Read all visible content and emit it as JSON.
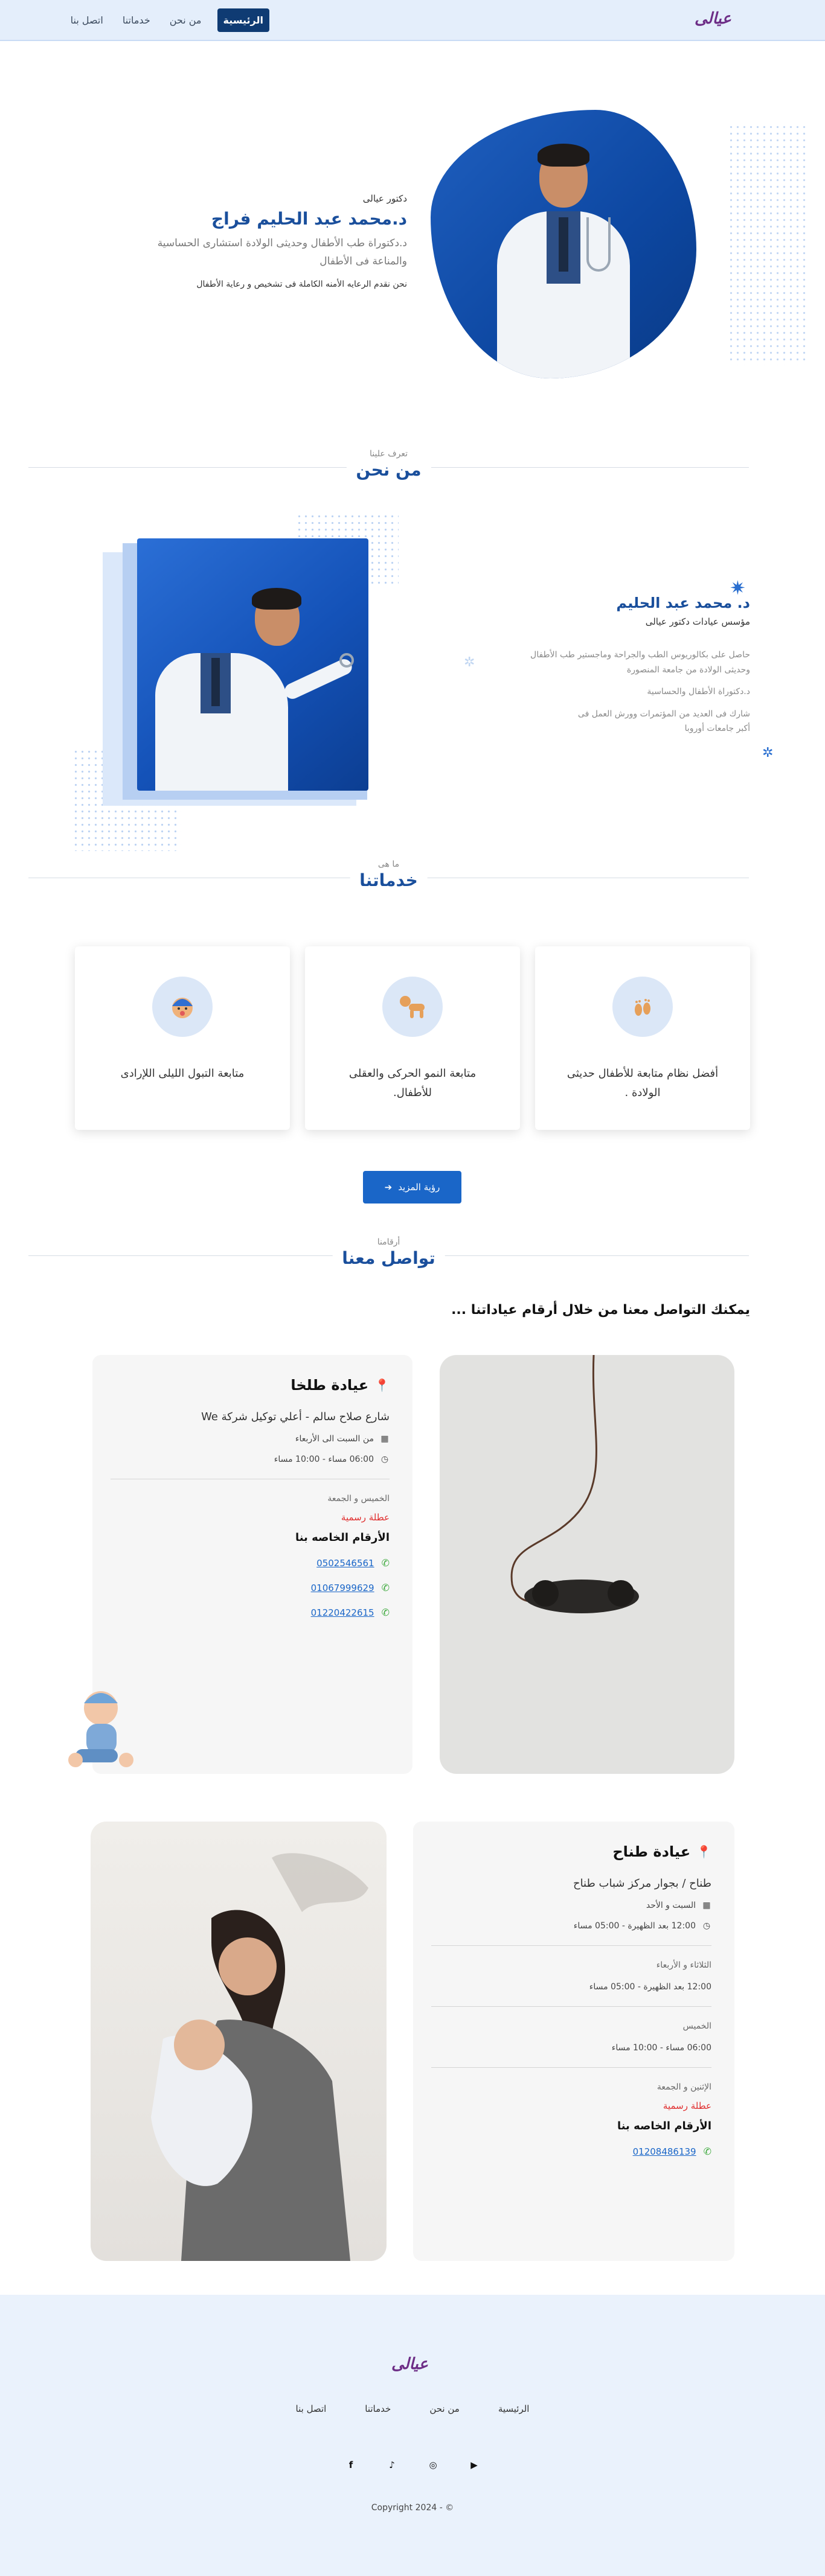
{
  "nav": {
    "brand": "عيالى",
    "links": [
      "الرئيسية",
      "من نحن",
      "خدماتنا",
      "اتصل بنا"
    ]
  },
  "hero": {
    "small": "دكتور عيالى",
    "name": "د.محمد عبد الحليم فراج",
    "desc1": "د.دكتوراة طب الأطفال وحديثى الولادة استشارى الحساسية",
    "desc2": "والمناعة فى الأطفال",
    "sub": "نحن نقدم الرعايه الأمنه الكاملة فى تشخيص و رعاية الأطفال"
  },
  "about": {
    "small": "تعرف علينا",
    "title": "من نحن",
    "name": "د. محمد عبد الحليم",
    "role": "مؤسس عيادات دكتور عيالى",
    "line1": "حاصل على بكالوريوس الطب والجراحة وماجستير طب الأطفال",
    "line2": "وحديثى الولادة من جامعة المنصورة",
    "line3": "د.دكتوراة الأطفال والحساسية",
    "line4": "شارك فى العديد من المؤتمرات وورش العمل فى",
    "line5": "أكبر جامعات أوروبا"
  },
  "services": {
    "small": "ما هى",
    "title": "خدماتنا",
    "cards": [
      {
        "title1": "أفضل نظام متابعة للأطفال حديثى",
        "title2": "الولادة .",
        "icon": "baby-feet-icon"
      },
      {
        "title1": "متابعة النمو الحركى والعقلى",
        "title2": "للأطفال.",
        "icon": "crawling-baby-icon"
      },
      {
        "title1": "متابعة التبول الليلى اللإرادى",
        "title2": "",
        "icon": "baby-face-icon"
      }
    ],
    "more": "رؤية المزيد"
  },
  "contact": {
    "small": "أرقامنا",
    "title": "تواصل معنا",
    "lead": "يمكنك التواصل معنا من خلال أرقام عياداتنا ...",
    "clinic1": {
      "title": "عيادة طلخا",
      "address": "شارع صلاح سالم - أعلي توكيل شركة We",
      "days": "من السبت الى الأربعاء",
      "time": "06:00 مساء - 10:00 مساء",
      "days2": "الخميس و الجمعة",
      "holiday": "عطلة رسمية",
      "phones_title": "الأرقام الخاصه بنا",
      "phones": [
        "0502546561",
        "01067999629",
        "01220422615"
      ]
    },
    "clinic2": {
      "title": "عيادة طناح",
      "address": "طناح / بجوار مركز شباب طناح",
      "d1": "السبت و الأحد",
      "t1": "12:00 بعد الظهيرة - 05:00 مساء",
      "d2": "الثلاثاء و الأربعاء",
      "t2": "12:00 بعد الظهيرة - 05:00 مساء",
      "d3": "الخميس",
      "t3": "06:00 مساء - 10:00 مساء",
      "d4": "الإثنين و الجمعة",
      "holiday": "عطلة رسمية",
      "phones_title": "الأرقام الخاصه بنا",
      "phones": [
        "01208486139"
      ]
    }
  },
  "footer": {
    "brand": "عيالى",
    "links": [
      "الرئيسية",
      "من نحن",
      "خدماتنا",
      "اتصل بنا"
    ],
    "copyright": "© - Copyright 2024"
  },
  "colors": {
    "primary": "#1a4f9c",
    "nav_active": "#0f3b73",
    "button": "#1a66c8",
    "holiday": "#e02d2d"
  }
}
